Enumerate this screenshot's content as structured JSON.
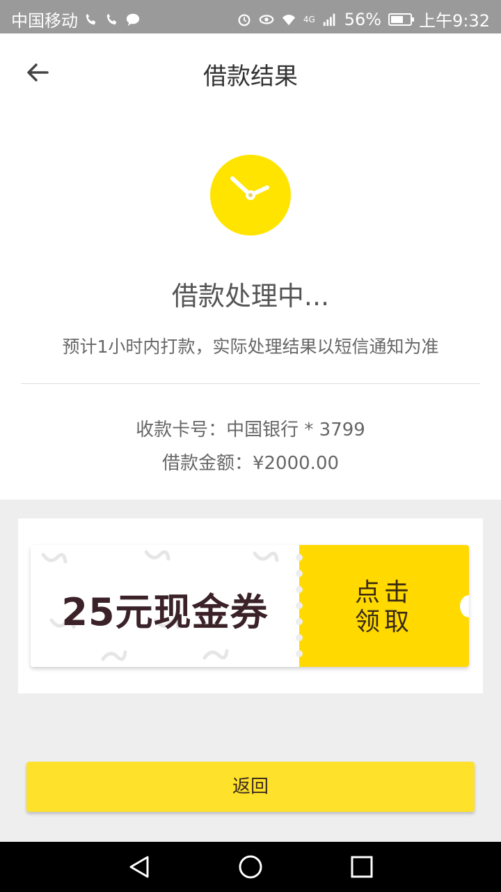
{
  "status_bar": {
    "carrier": "中国移动",
    "network": "4G",
    "battery": "56%",
    "time": "上午9:32"
  },
  "app_bar": {
    "title": "借款结果"
  },
  "result": {
    "title": "借款处理中...",
    "description": "预计1小时内打款，实际处理结果以短信通知为准",
    "card_line": "收款卡号：中国银行 * 3799",
    "amount_line": "借款金额：¥2000.00"
  },
  "coupon": {
    "amount": "25元现金券",
    "claim_line1": "点击",
    "claim_line2": "领取"
  },
  "return_button": "返回",
  "colors": {
    "accent": "#ffe400",
    "coupon_yellow": "#ffd900",
    "button_yellow": "#fee12b"
  }
}
